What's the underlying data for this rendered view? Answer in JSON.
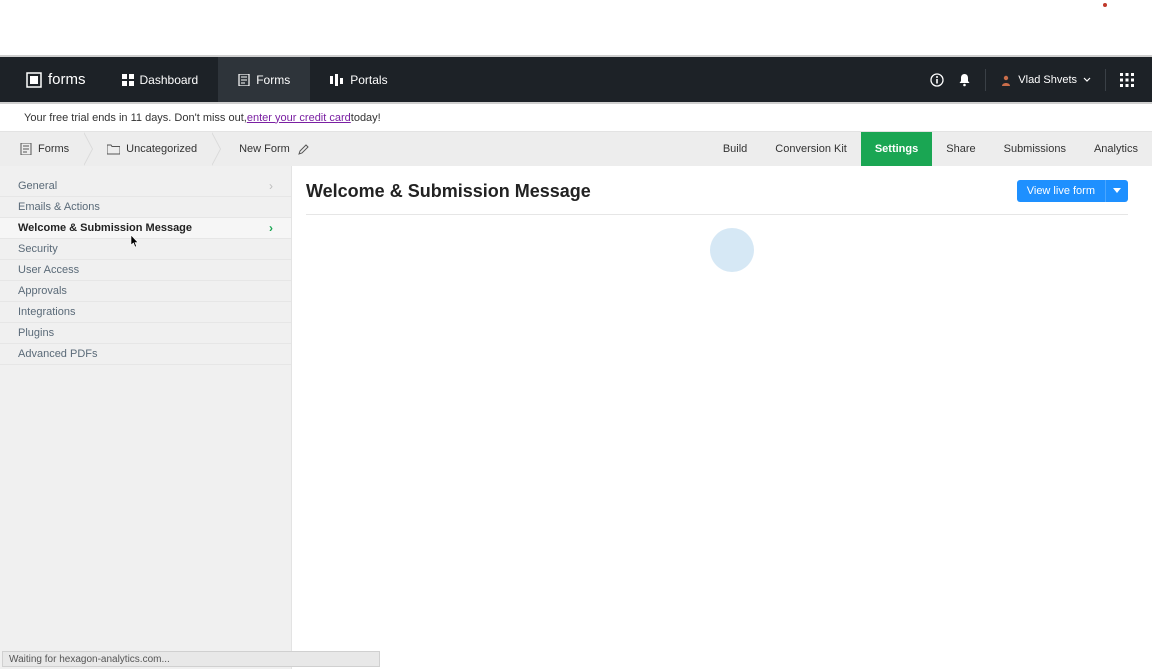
{
  "brand": {
    "name": "forms"
  },
  "topnav": {
    "items": [
      {
        "label": "Dashboard",
        "icon": "dashboard-icon"
      },
      {
        "label": "Forms",
        "icon": "forms-icon"
      },
      {
        "label": "Portals",
        "icon": "portals-icon"
      }
    ],
    "active_index": 1
  },
  "user": {
    "name": "Vlad Shvets"
  },
  "trial": {
    "prefix": "Your free trial ends in 11 days. Don't miss out, ",
    "link": "enter your credit card",
    "suffix": " today!"
  },
  "breadcrumb": {
    "items": [
      {
        "label": "Forms",
        "icon": "form-list-icon"
      },
      {
        "label": "Uncategorized",
        "icon": "folder-icon"
      },
      {
        "label": "New Form",
        "editable": true
      }
    ]
  },
  "tabs": {
    "items": [
      "Build",
      "Conversion Kit",
      "Settings",
      "Share",
      "Submissions",
      "Analytics"
    ],
    "active_index": 2
  },
  "sidebar": {
    "items": [
      "General",
      "Emails & Actions",
      "Welcome & Submission Message",
      "Security",
      "User Access",
      "Approvals",
      "Integrations",
      "Plugins",
      "Advanced PDFs"
    ],
    "active_index": 2
  },
  "content": {
    "title": "Welcome & Submission Message",
    "view_live_label": "View live form"
  },
  "status": {
    "text": "Waiting for hexagon-analytics.com..."
  }
}
